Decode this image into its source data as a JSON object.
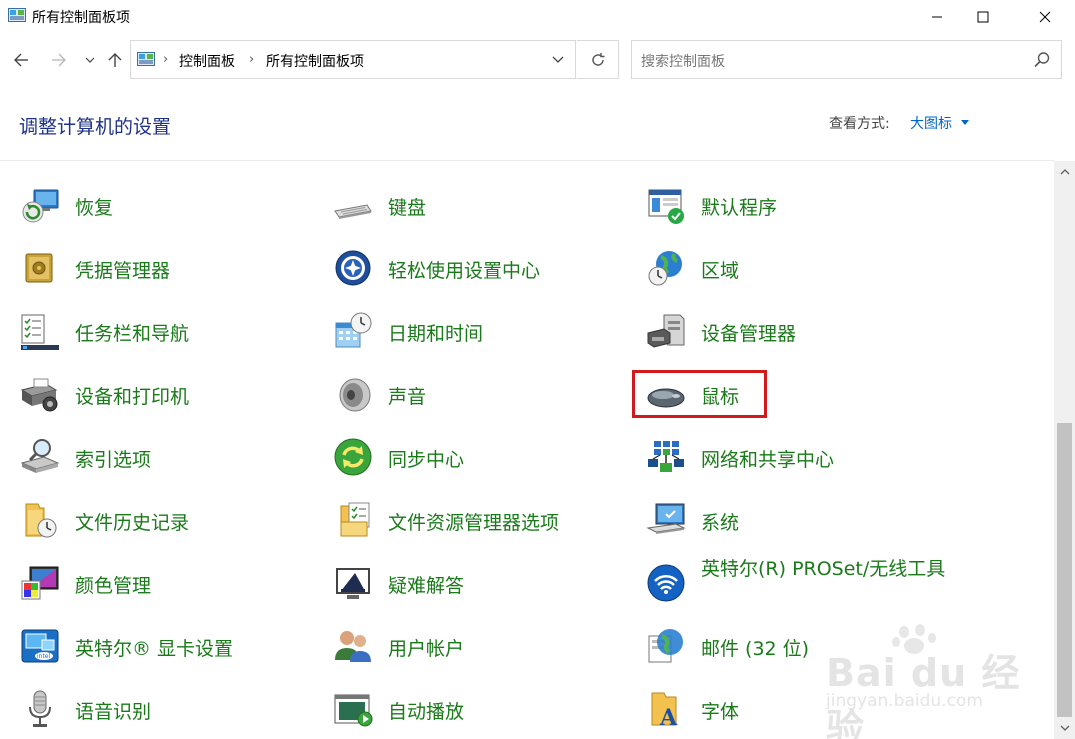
{
  "window": {
    "title": "所有控制面板项"
  },
  "breadcrumbs": [
    "控制面板",
    "所有控制面板项"
  ],
  "search": {
    "placeholder": "搜索控制面板"
  },
  "header": {
    "title": "调整计算机的设置",
    "view_label": "查看方式:",
    "view_value": "大图标"
  },
  "items": [
    {
      "label": "恢复",
      "icon": "recovery-icon"
    },
    {
      "label": "键盘",
      "icon": "keyboard-icon"
    },
    {
      "label": "默认程序",
      "icon": "default-programs-icon"
    },
    {
      "label": "凭据管理器",
      "icon": "credential-manager-icon"
    },
    {
      "label": "轻松使用设置中心",
      "icon": "ease-of-access-icon"
    },
    {
      "label": "区域",
      "icon": "region-globe-icon"
    },
    {
      "label": "任务栏和导航",
      "icon": "taskbar-icon"
    },
    {
      "label": "日期和时间",
      "icon": "date-time-icon"
    },
    {
      "label": "设备管理器",
      "icon": "device-manager-icon"
    },
    {
      "label": "设备和打印机",
      "icon": "printer-icon"
    },
    {
      "label": "声音",
      "icon": "speaker-icon"
    },
    {
      "label": "鼠标",
      "icon": "mouse-icon"
    },
    {
      "label": "索引选项",
      "icon": "indexing-icon"
    },
    {
      "label": "同步中心",
      "icon": "sync-icon"
    },
    {
      "label": "网络和共享中心",
      "icon": "network-icon"
    },
    {
      "label": "文件历史记录",
      "icon": "file-history-icon"
    },
    {
      "label": "文件资源管理器选项",
      "icon": "folder-options-icon"
    },
    {
      "label": "系统",
      "icon": "system-monitor-icon"
    },
    {
      "label": "颜色管理",
      "icon": "color-management-icon"
    },
    {
      "label": "疑难解答",
      "icon": "troubleshooting-icon"
    },
    {
      "label": "英特尔(R) PROSet/无线工具",
      "icon": "wireless-icon"
    },
    {
      "label": "英特尔® 显卡设置",
      "icon": "intel-graphics-icon"
    },
    {
      "label": "用户帐户",
      "icon": "user-accounts-icon"
    },
    {
      "label": "邮件 (32 位)",
      "icon": "mail-icon"
    },
    {
      "label": "语音识别",
      "icon": "microphone-icon"
    },
    {
      "label": "自动播放",
      "icon": "autoplay-icon"
    },
    {
      "label": "字体",
      "icon": "fonts-icon"
    }
  ],
  "watermark": {
    "brand": "Bai du 经验",
    "url": "jingyan.baidu.com"
  },
  "colors": {
    "item_text": "#1a7a1a",
    "title": "#1e3287",
    "link": "#0066cc",
    "highlight": "#d11a1a"
  }
}
